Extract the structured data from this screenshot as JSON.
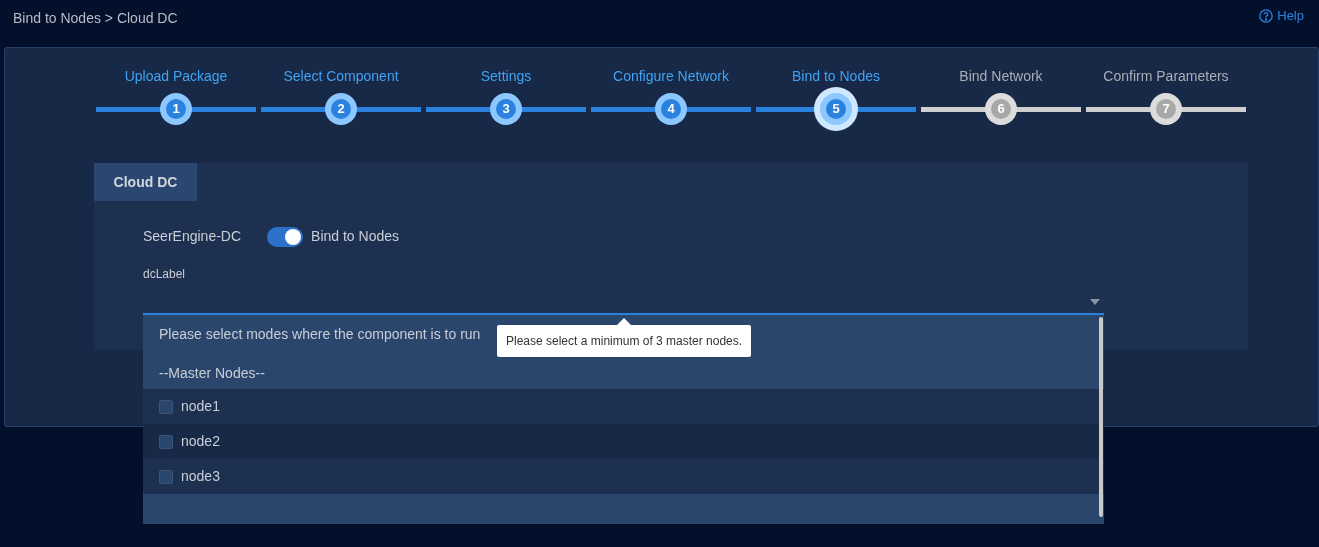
{
  "breadcrumb": "Bind to Nodes > Cloud DC",
  "help": "Help",
  "steps": [
    {
      "label": "Upload Package",
      "number": "1",
      "kind": "done"
    },
    {
      "label": "Select Component",
      "number": "2",
      "kind": "done"
    },
    {
      "label": "Settings",
      "number": "3",
      "kind": "done"
    },
    {
      "label": "Configure Network",
      "number": "4",
      "kind": "done"
    },
    {
      "label": "Bind to Nodes",
      "number": "5",
      "kind": "active"
    },
    {
      "label": "Bind Network",
      "number": "6",
      "kind": "todo"
    },
    {
      "label": "Confirm Parameters",
      "number": "7",
      "kind": "todo"
    }
  ],
  "section_tab": "Cloud DC",
  "component": {
    "name": "SeerEngine-DC",
    "toggle_label": "Bind to Nodes",
    "on": true
  },
  "field_label": "dcLabel",
  "dropdown": {
    "hint": "Please select modes where the component is to run",
    "group": "--Master Nodes--",
    "options": [
      {
        "label": "node1",
        "checked": false
      },
      {
        "label": "node2",
        "checked": false
      },
      {
        "label": "node3",
        "checked": false
      }
    ]
  },
  "tooltip": "Please select a minimum of 3 master nodes."
}
